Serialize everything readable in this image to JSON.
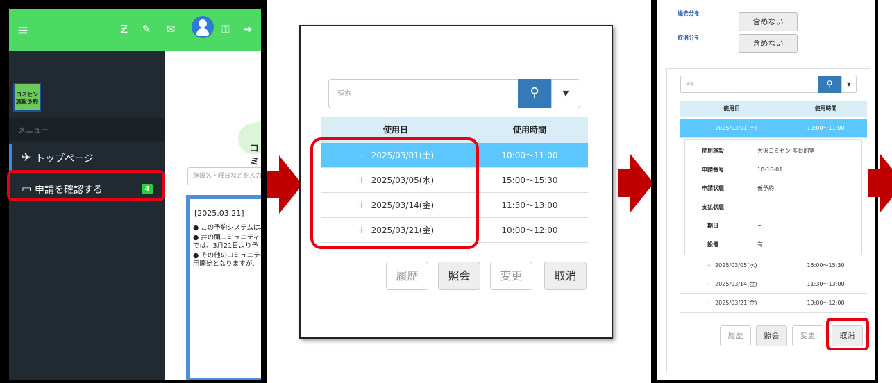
{
  "panel1": {
    "menu_label": "メニュー",
    "logo_text": "コミセン\n施設予約",
    "nav_items": [
      {
        "label": "トップページ",
        "icon": "plane-icon"
      },
      {
        "label": "申請を確認する",
        "icon": "laptop-icon",
        "badge": "4"
      }
    ],
    "main_title": "コミ",
    "search_placeholder": "施設名・曜日などを入力",
    "notice": {
      "date": "[2025.03.21]",
      "lines": [
        "● この予約システムは、",
        "● 井の頭コミュニティ・",
        "   では、3月21日より予",
        "● その他のコミュニティ",
        "   用開始となりますが、"
      ]
    },
    "toolbar_icons": [
      "text-format-icon",
      "brush-icon",
      "mail-icon",
      "user-avatar-icon",
      "key-icon",
      "logout-icon"
    ],
    "colors": {
      "topbar": "#4cd964",
      "sidebar": "#212a30",
      "highlight": "#e60012"
    }
  },
  "panel2": {
    "search_placeholder": "検索",
    "columns": [
      "使用日",
      "使用時間"
    ],
    "rows": [
      {
        "date": "2025/03/01(土)",
        "time": "10:00〜11:00",
        "expanded": true
      },
      {
        "date": "2025/03/05(水)",
        "time": "15:00〜15:30",
        "expanded": false
      },
      {
        "date": "2025/03/14(金)",
        "time": "11:30〜13:00",
        "expanded": false
      },
      {
        "date": "2025/03/21(金)",
        "time": "10:00〜12:00",
        "expanded": false
      }
    ],
    "buttons": [
      "履歴",
      "照会",
      "変更",
      "取消"
    ]
  },
  "panel3": {
    "filters": [
      {
        "label": "過去分を",
        "value": "含めない"
      },
      {
        "label": "取消分を",
        "value": "含めない"
      }
    ],
    "search_placeholder": "検索",
    "columns": [
      "使用日",
      "使用時間"
    ],
    "selected": {
      "date": "2025/03/01(土)",
      "time": "10:00〜11:00"
    },
    "details": [
      {
        "key": "使用施設",
        "value": "大沢コミセン 多目的室"
      },
      {
        "key": "申請番号",
        "value": "10-16-01"
      },
      {
        "key": "申請状態",
        "value": "仮予約"
      },
      {
        "key": "支払状態",
        "value": "−"
      },
      {
        "key": "期日",
        "value": "−"
      },
      {
        "key": "設備",
        "value": "有"
      }
    ],
    "rows": [
      {
        "date": "2025/03/05(水)",
        "time": "15:00〜15:30"
      },
      {
        "date": "2025/03/14(金)",
        "time": "11:30〜13:00"
      },
      {
        "date": "2025/03/21(金)",
        "time": "10:00〜12:00"
      }
    ],
    "buttons": [
      "履歴",
      "照会",
      "変更",
      "取消"
    ]
  },
  "arrow_color": "#c00000"
}
